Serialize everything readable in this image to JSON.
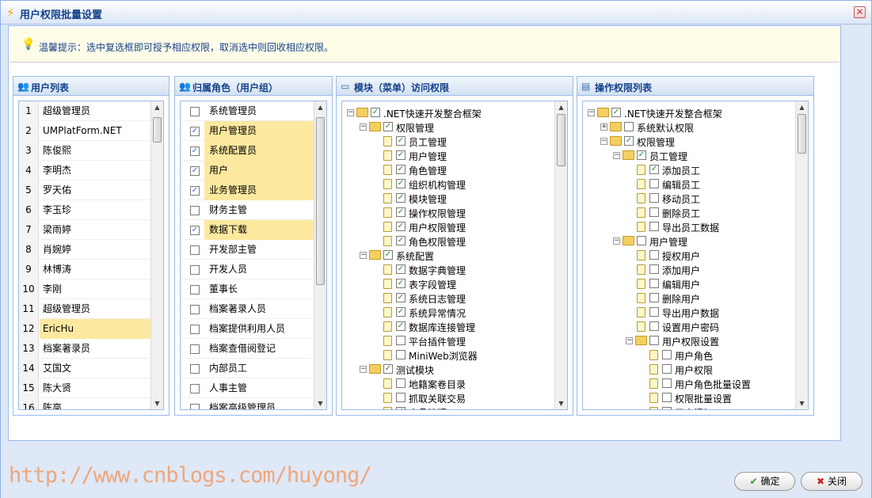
{
  "window": {
    "title": "用户权限批量设置",
    "close_glyph": "✕"
  },
  "tip": {
    "text": "温馨提示：选中复选框即可授予相应权限，取消选中则回收相应权限。"
  },
  "panels": {
    "users": {
      "title": "用户列表"
    },
    "roles": {
      "title": "归属角色（用户组）"
    },
    "modules": {
      "title": "模块（菜单）访问权限"
    },
    "operations": {
      "title": "操作权限列表"
    }
  },
  "users": [
    {
      "num": "1",
      "name": "超级管理员"
    },
    {
      "num": "2",
      "name": "UMPlatForm.NET"
    },
    {
      "num": "3",
      "name": "陈俊熙"
    },
    {
      "num": "4",
      "name": "李明杰"
    },
    {
      "num": "5",
      "name": "罗天佑"
    },
    {
      "num": "6",
      "name": "李玉珍"
    },
    {
      "num": "7",
      "name": "梁雨婷"
    },
    {
      "num": "8",
      "name": "肖婉婷"
    },
    {
      "num": "9",
      "name": "林博涛"
    },
    {
      "num": "10",
      "name": "李刚"
    },
    {
      "num": "11",
      "name": "超级管理员"
    },
    {
      "num": "12",
      "name": "EricHu",
      "selected": true
    },
    {
      "num": "13",
      "name": "档案著录员"
    },
    {
      "num": "14",
      "name": "艾国文"
    },
    {
      "num": "15",
      "name": "陈大贤"
    },
    {
      "num": "16",
      "name": "陈亮"
    }
  ],
  "roles": [
    {
      "name": "系统管理员",
      "checked": false
    },
    {
      "name": "用户管理员",
      "checked": true
    },
    {
      "name": "系统配置员",
      "checked": true
    },
    {
      "name": "用户",
      "checked": true
    },
    {
      "name": "业务管理员",
      "checked": true
    },
    {
      "name": "财务主管",
      "checked": false
    },
    {
      "name": "数据下载",
      "checked": true
    },
    {
      "name": "开发部主管",
      "checked": false
    },
    {
      "name": "开发人员",
      "checked": false
    },
    {
      "name": "董事长",
      "checked": false
    },
    {
      "name": "档案著录人员",
      "checked": false
    },
    {
      "name": "档案提供利用人员",
      "checked": false
    },
    {
      "name": "档案查借阅登记",
      "checked": false
    },
    {
      "name": "内部员工",
      "checked": false
    },
    {
      "name": "人事主管",
      "checked": false
    },
    {
      "name": "档案高级管理员",
      "checked": false
    }
  ],
  "module_tree": [
    {
      "level": 0,
      "label": ".NET快速开发整合框架",
      "folder": true,
      "exp": "−",
      "checked": true
    },
    {
      "level": 1,
      "label": "权限管理",
      "folder": true,
      "exp": "−",
      "checked": true
    },
    {
      "level": 2,
      "label": "员工管理",
      "checked": true
    },
    {
      "level": 2,
      "label": "用户管理",
      "checked": true
    },
    {
      "level": 2,
      "label": "角色管理",
      "checked": true
    },
    {
      "level": 2,
      "label": "组织机构管理",
      "checked": true
    },
    {
      "level": 2,
      "label": "模块管理",
      "checked": true
    },
    {
      "level": 2,
      "label": "操作权限管理",
      "checked": true
    },
    {
      "level": 2,
      "label": "用户权限管理",
      "checked": true
    },
    {
      "level": 2,
      "label": "角色权限管理",
      "checked": true
    },
    {
      "level": 1,
      "label": "系统配置",
      "folder": true,
      "exp": "−",
      "checked": true
    },
    {
      "level": 2,
      "label": "数据字典管理",
      "checked": true
    },
    {
      "level": 2,
      "label": "表字段管理",
      "checked": true
    },
    {
      "level": 2,
      "label": "系统日志管理",
      "checked": true
    },
    {
      "level": 2,
      "label": "系统异常情况",
      "checked": true
    },
    {
      "level": 2,
      "label": "数据库连接管理",
      "checked": true
    },
    {
      "level": 2,
      "label": "平台插件管理",
      "checked": false
    },
    {
      "level": 2,
      "label": "MiniWeb浏览器",
      "checked": false
    },
    {
      "level": 1,
      "label": "测试模块",
      "folder": true,
      "exp": "−",
      "checked": true
    },
    {
      "level": 2,
      "label": "地籍案卷目录",
      "checked": false
    },
    {
      "level": 2,
      "label": "抓取关联交易",
      "checked": false
    },
    {
      "level": 2,
      "label": "产品管理",
      "checked": true
    }
  ],
  "operation_tree": [
    {
      "level": 0,
      "label": ".NET快速开发整合框架",
      "folder": true,
      "exp": "−",
      "checked": true
    },
    {
      "level": 1,
      "label": "系统默认权限",
      "folder": true,
      "exp": "+",
      "checked": false
    },
    {
      "level": 1,
      "label": "权限管理",
      "folder": true,
      "exp": "−",
      "checked": true
    },
    {
      "level": 2,
      "label": "员工管理",
      "folder": true,
      "exp": "−",
      "checked": true
    },
    {
      "level": 3,
      "label": "添加员工",
      "checked": true
    },
    {
      "level": 3,
      "label": "编辑员工",
      "checked": false
    },
    {
      "level": 3,
      "label": "移动员工",
      "checked": false
    },
    {
      "level": 3,
      "label": "删除员工",
      "checked": false
    },
    {
      "level": 3,
      "label": "导出员工数据",
      "checked": false
    },
    {
      "level": 2,
      "label": "用户管理",
      "folder": true,
      "exp": "−",
      "checked": false
    },
    {
      "level": 3,
      "label": "授权用户",
      "checked": false
    },
    {
      "level": 3,
      "label": "添加用户",
      "checked": false
    },
    {
      "level": 3,
      "label": "编辑用户",
      "checked": false
    },
    {
      "level": 3,
      "label": "删除用户",
      "checked": false
    },
    {
      "level": 3,
      "label": "导出用户数据",
      "checked": false
    },
    {
      "level": 3,
      "label": "设置用户密码",
      "checked": false
    },
    {
      "level": 3,
      "label": "用户权限设置",
      "folder": true,
      "exp": "−",
      "checked": false
    },
    {
      "level": 4,
      "label": "用户角色",
      "checked": false
    },
    {
      "level": 4,
      "label": "用户权限",
      "checked": false
    },
    {
      "level": 4,
      "label": "用户角色批量设置",
      "checked": false
    },
    {
      "level": 4,
      "label": "权限批量设置",
      "checked": false
    },
    {
      "level": 4,
      "label": "用户授权",
      "checked": false
    }
  ],
  "footer": {
    "watermark": "http://www.cnblogs.com/huyong/",
    "ok_label": "确定",
    "cancel_label": "关闭"
  }
}
